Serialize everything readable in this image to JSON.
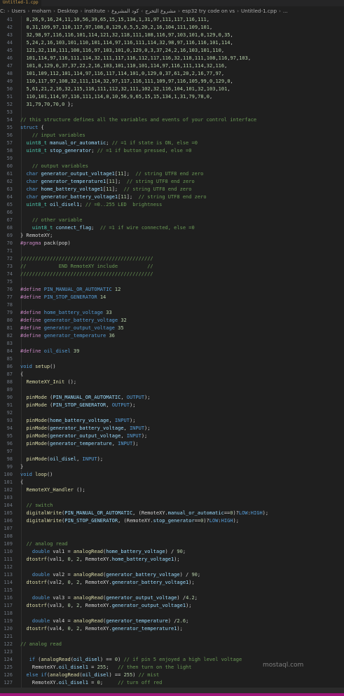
{
  "tab": {
    "label": "Untitled-1.cpp"
  },
  "breadcrumb": [
    "C:",
    "Users",
    "moharn",
    "Desktop",
    "institute",
    "مشروع التخرج",
    "كود المشروع",
    "esp32 try code on vs",
    "Untitled-1.cpp",
    "..."
  ],
  "colors": {
    "keyword": "#569cd6",
    "type": "#4ec9b0",
    "function": "#dcdcaa",
    "string": "#ce9178",
    "number": "#b5cea8",
    "comment": "#6a9955",
    "macro": "#c586c0",
    "variable": "#9cdcfe",
    "text": "#d4d4d4",
    "line_number": "#6e7681",
    "accent": "#a0157a"
  },
  "lines": [
    {
      "n": "41",
      "t": "  8,26,9,16,24,11,10,56,39,65,15,15,134,1,31,97,111,117,116,111,"
    },
    {
      "n": "42",
      "t": "  0,31,109,97,110,117,97,108,0,129,0,5,5,20,2,16,104,111,109,101,"
    },
    {
      "n": "43",
      "t": "  32,98,97,116,116,101,114,121,32,118,111,108,116,97,103,101,0,129,0,35,"
    },
    {
      "n": "44",
      "t": "  5,24,2,16,103,101,110,101,114,97,116,111,114,32,98,97,116,116,101,114,"
    },
    {
      "n": "45",
      "t": "  121,32,118,111,108,116,97,103,101,0,129,0,3,37,24,2,16,103,101,110,"
    },
    {
      "n": "46",
      "t": "  101,114,97,116,111,114,32,111,117,116,112,117,116,32,118,111,108,116,97,103,"
    },
    {
      "n": "47",
      "t": "  101,0,129,0,37,37,22,2,16,103,101,110,101,114,97,116,111,114,32,116,"
    },
    {
      "n": "48",
      "t": "  101,109,112,101,114,97,116,117,114,101,0,129,0,37,61,20,2,16,77,97,"
    },
    {
      "n": "49",
      "t": "  110,117,97,108,32,111,114,32,97,117,116,111,109,97,116,105,99,0,129,0,"
    },
    {
      "n": "50",
      "t": "  5,61,21,2,16,32,115,116,111,112,32,111,102,32,116,104,101,32,103,101,"
    },
    {
      "n": "51",
      "t": "  110,101,114,97,116,111,114,0,10,56,9,65,15,15,134,1,31,79,78,0,"
    },
    {
      "n": "52",
      "t": "  31,79,70,70,0 };"
    },
    {
      "n": "53",
      "t": ""
    },
    {
      "n": "54",
      "t": "// this structure defines all the variables and events of your control interface"
    },
    {
      "n": "55",
      "t": "struct {"
    },
    {
      "n": "56",
      "t": "    // input variables"
    },
    {
      "n": "57",
      "t": "  uint8_t manual_or_automatic; // =1 if state is ON, else =0"
    },
    {
      "n": "58",
      "t": "  uint8_t stop_generator; // =1 if button pressed, else =0"
    },
    {
      "n": "59",
      "t": ""
    },
    {
      "n": "60",
      "t": "    // output variables"
    },
    {
      "n": "61",
      "t": "  char generator_output_voltage1[11];  // string UTF8 end zero"
    },
    {
      "n": "62",
      "t": "  char generator_temperature1[11];  // string UTF8 end zero"
    },
    {
      "n": "63",
      "t": "  char home_battery_voltage1[11];  // string UTF8 end zero"
    },
    {
      "n": "64",
      "t": "  char generator_battery_voltage1[11];  // string UTF8 end zero"
    },
    {
      "n": "65",
      "t": "  uint8_t oil_disel1; // =0..255 LED  brightness"
    },
    {
      "n": "66",
      "t": ""
    },
    {
      "n": "67",
      "t": "    // other variable"
    },
    {
      "n": "68",
      "t": "    uint8_t connect_flag;  // =1 if wire connected, else =0"
    },
    {
      "n": "69",
      "t": "} RemoteXY;"
    },
    {
      "n": "70",
      "t": "#pragma pack(pop)"
    },
    {
      "n": "71",
      "t": ""
    },
    {
      "n": "72",
      "t": "/////////////////////////////////////////////"
    },
    {
      "n": "73",
      "t": "//           END RemoteXY include          //"
    },
    {
      "n": "74",
      "t": "/////////////////////////////////////////////"
    },
    {
      "n": "75",
      "t": ""
    },
    {
      "n": "76",
      "t": "#define PIN_MANUAL_OR_AUTOMATIC 12"
    },
    {
      "n": "77",
      "t": "#define PIN_STOP_GENERATOR 14"
    },
    {
      "n": "78",
      "t": ""
    },
    {
      "n": "79",
      "t": "#define home_battery_voltage 33"
    },
    {
      "n": "80",
      "t": "#define generator_battery_voltage 32"
    },
    {
      "n": "81",
      "t": "#define generator_output_voltage 35"
    },
    {
      "n": "82",
      "t": "#define generator_temperature 36"
    },
    {
      "n": "83",
      "t": ""
    },
    {
      "n": "84",
      "t": "#define oil_disel 39"
    },
    {
      "n": "85",
      "t": ""
    },
    {
      "n": "86",
      "t": "void setup()"
    },
    {
      "n": "87",
      "t": "{"
    },
    {
      "n": "88",
      "t": "  RemoteXY_Init ();"
    },
    {
      "n": "89",
      "t": ""
    },
    {
      "n": "90",
      "t": "  pinMode (PIN_MANUAL_OR_AUTOMATIC, OUTPUT);"
    },
    {
      "n": "91",
      "t": "  pinMode (PIN_STOP_GENERATOR, OUTPUT);"
    },
    {
      "n": "92",
      "t": ""
    },
    {
      "n": "93",
      "t": "  pinMode(home_battery_voltage, INPUT);"
    },
    {
      "n": "94",
      "t": "  pinMode(generator_battery_voltage, INPUT);"
    },
    {
      "n": "95",
      "t": "  pinMode(generator_output_voltage, INPUT);"
    },
    {
      "n": "96",
      "t": "  pinMode(generator_temperature, INPUT);"
    },
    {
      "n": "97",
      "t": ""
    },
    {
      "n": "98",
      "t": "  pinMode(oil_disel, INPUT);"
    },
    {
      "n": "99",
      "t": "}"
    },
    {
      "n": "100",
      "t": "void loop()"
    },
    {
      "n": "101",
      "t": "{"
    },
    {
      "n": "102",
      "t": "  RemoteXY_Handler ();"
    },
    {
      "n": "103",
      "t": ""
    },
    {
      "n": "104",
      "t": "  // switch"
    },
    {
      "n": "105",
      "t": "  digitalWrite(PIN_MANUAL_OR_AUTOMATIC, (RemoteXY.manual_or_automatic==0)?LOW:HIGH);"
    },
    {
      "n": "106",
      "t": "  digitalWrite(PIN_STOP_GENERATOR, (RemoteXY.stop_generator==0)?LOW:HIGH);"
    },
    {
      "n": "107",
      "t": ""
    },
    {
      "n": "108",
      "t": ""
    },
    {
      "n": "109",
      "t": "  // analog read"
    },
    {
      "n": "110",
      "t": "    double val1 = analogRead(home_battery_voltage) / 90;"
    },
    {
      "n": "111",
      "t": "  dtostrf(val1, 0, 2, RemoteXY.home_battery_voltage1);"
    },
    {
      "n": "112",
      "t": ""
    },
    {
      "n": "113",
      "t": "    double val2 = analogRead(generator_battery_voltage) / 90;"
    },
    {
      "n": "114",
      "t": "  dtostrf(val2, 0, 2, RemoteXY.generator_battery_voltage1);"
    },
    {
      "n": "115",
      "t": ""
    },
    {
      "n": "116",
      "t": "    double val3 = analogRead(generator_output_voltage) /4.2;"
    },
    {
      "n": "117",
      "t": "  dtostrf(val3, 0, 2, RemoteXY.generator_output_voltage1);"
    },
    {
      "n": "118",
      "t": ""
    },
    {
      "n": "119",
      "t": "    double val4 = analogRead(generator_temperature) /2.6;"
    },
    {
      "n": "120",
      "t": "  dtostrf(val4, 0, 2, RemoteXY.generator_temperature1);"
    },
    {
      "n": "121",
      "t": ""
    },
    {
      "n": "122",
      "t": "// analog read"
    },
    {
      "n": "123",
      "t": ""
    },
    {
      "n": "124",
      "t": "   if (analogRead(oil_disel) == 0) // if pin 5 enjoyed a high level voltage"
    },
    {
      "n": "125",
      "t": "    RemoteXY.oil_disel1 = 255;   // then turn on the light"
    },
    {
      "n": "126",
      "t": "  else if(analogRead(oil_disel) == 255) // mist"
    },
    {
      "n": "127",
      "t": "    RemoteXY.oil_disel1 = 0;     // turn off red"
    }
  ],
  "watermark": "mostaql.com"
}
